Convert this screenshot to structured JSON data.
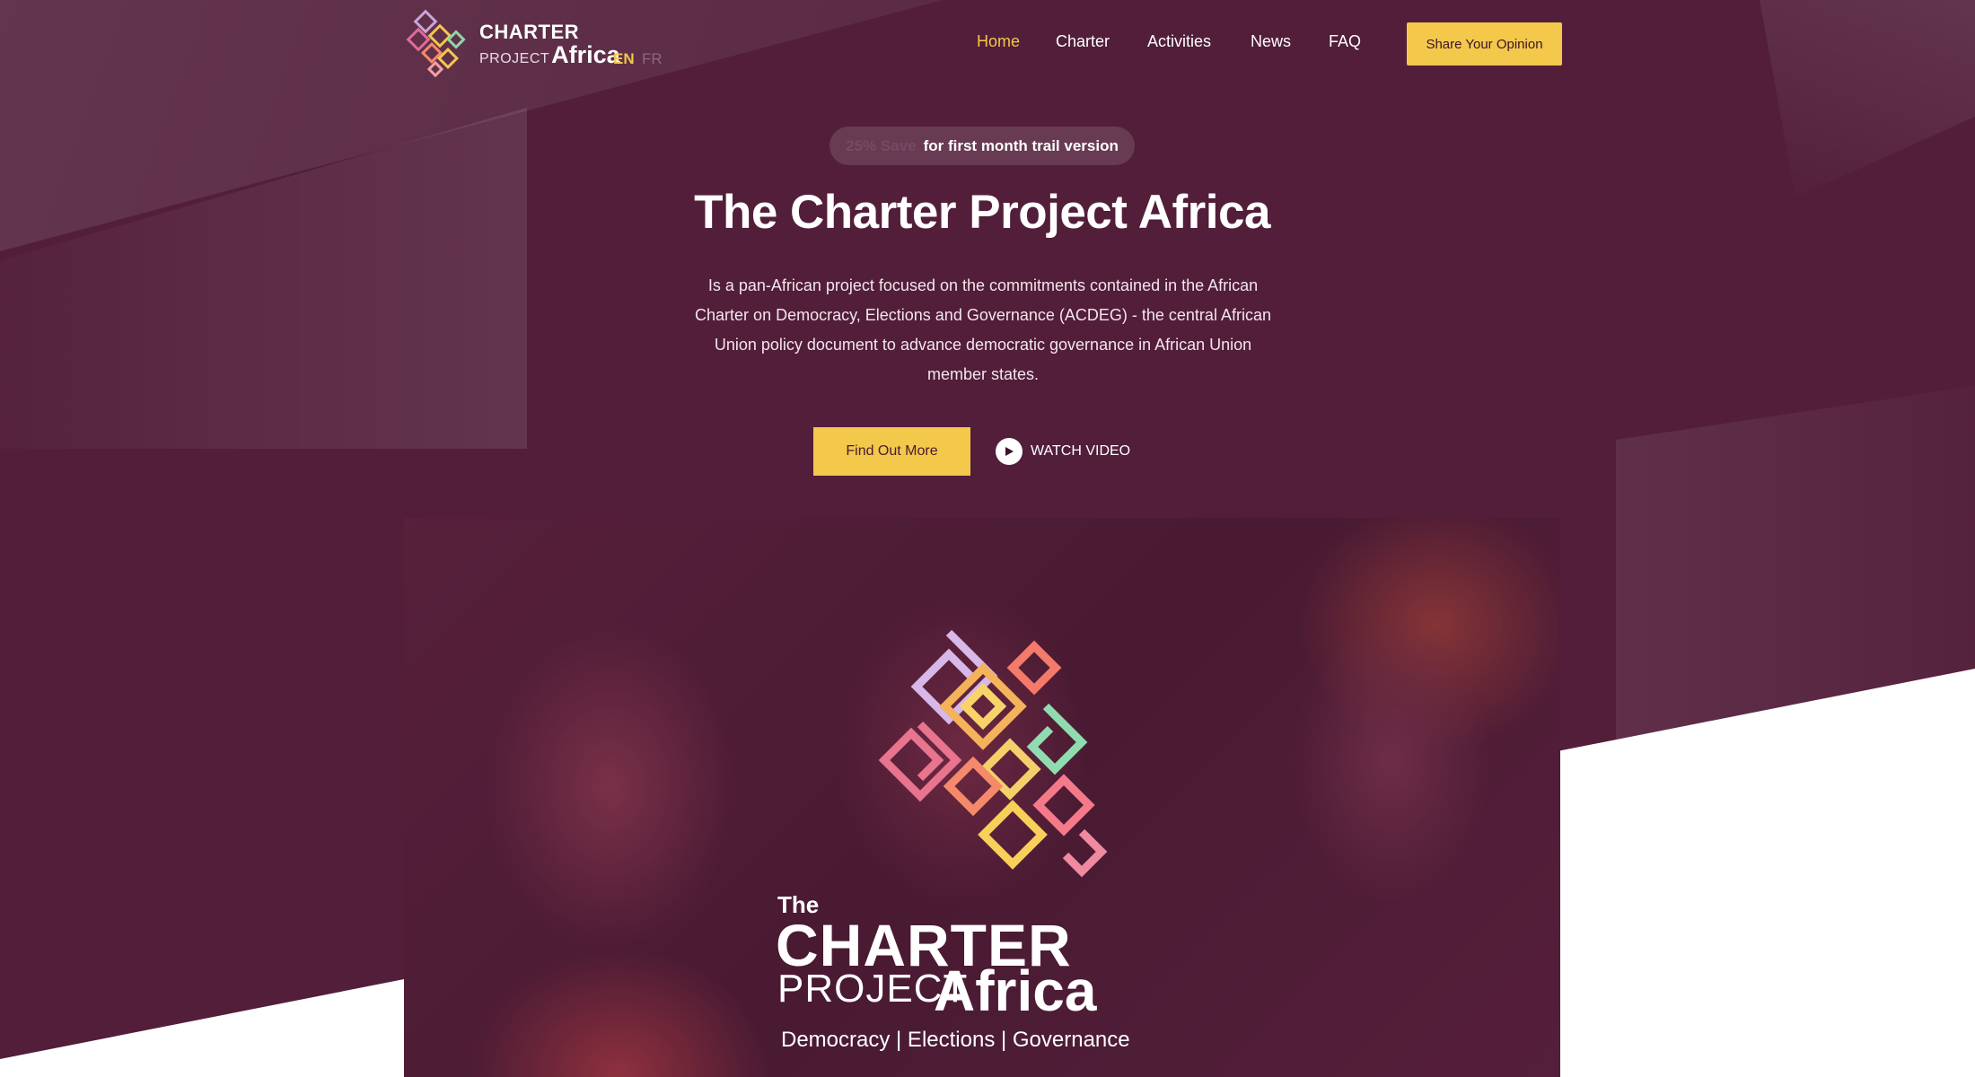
{
  "logo": {
    "line1": "CHARTER",
    "line2a": "PROJECT",
    "line2b": "Africa"
  },
  "languages": {
    "en": "EN",
    "fr": "FR",
    "active": "EN"
  },
  "nav": {
    "items": [
      "Home",
      "Charter",
      "Activities",
      "News",
      "FAQ"
    ],
    "active": "Home"
  },
  "cta": {
    "share_opinion": "Share Your Opinion"
  },
  "promo": {
    "save": "25% Save",
    "text": "for first month trail version"
  },
  "hero": {
    "title": "The Charter Project Africa",
    "description": "Is a pan-African project focused on the commitments contained in the African Charter on Democracy, Elections and Governance (ACDEG) - the central African Union policy document to advance democratic governance in African Union member states.",
    "find_out_more": "Find Out More",
    "watch_video": "WATCH VIDEO"
  },
  "hero_image": {
    "the": "The",
    "charter": "CHARTER",
    "project": "PROJECT",
    "africa": "Africa",
    "tagline": "Democracy | Elections | Governance"
  },
  "colors": {
    "background": "#521e3a",
    "accent": "#f3c84b",
    "text": "#ffffff"
  }
}
